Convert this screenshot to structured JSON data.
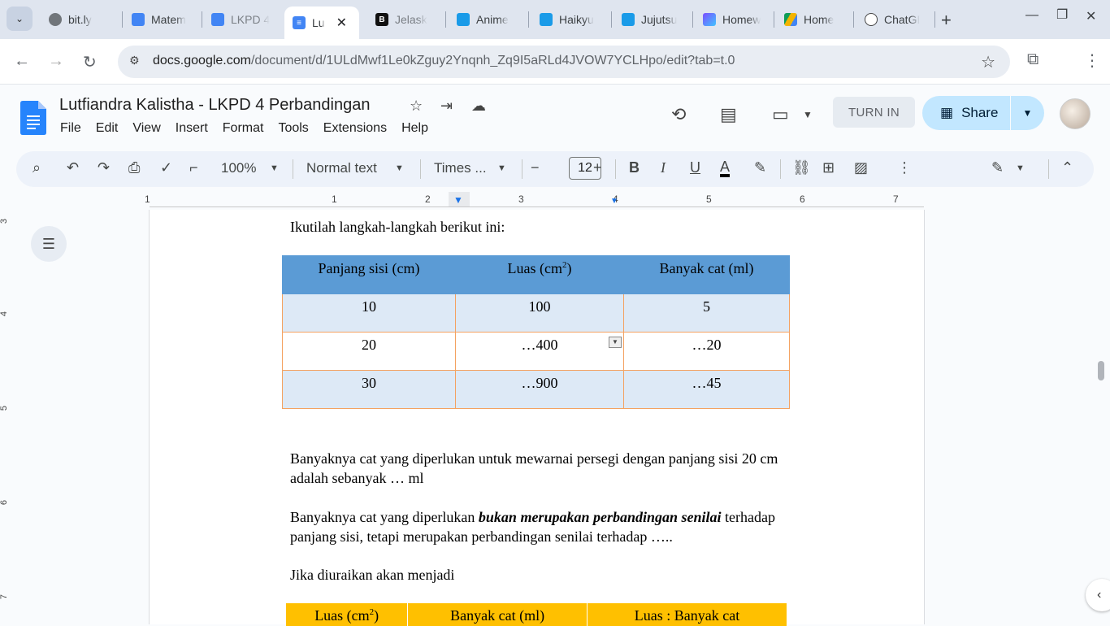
{
  "browser": {
    "tabs": [
      {
        "label": "bit.ly",
        "icon": "globe-icon"
      },
      {
        "label": "Matem",
        "icon": "classroom-icon"
      },
      {
        "label": "LKPD 4",
        "icon": "classroom-icon"
      },
      {
        "label": "Lu",
        "icon": "docs-icon",
        "active": true
      },
      {
        "label": "Jelask",
        "icon": "brainly-icon"
      },
      {
        "label": "Anime",
        "icon": "robot-icon"
      },
      {
        "label": "Haikyu",
        "icon": "robot-icon"
      },
      {
        "label": "Jujutsu",
        "icon": "robot-icon"
      },
      {
        "label": "Homew",
        "icon": "hexagon-icon"
      },
      {
        "label": "Home",
        "icon": "drive-icon"
      },
      {
        "label": "ChatGI",
        "icon": "openai-icon"
      }
    ],
    "url_domain": "docs.google.com",
    "url_path": "/document/d/1ULdMwf1Le0kZguy2Ynqnh_Zq9I5aRLd4JVOW7YCLHpo/edit?tab=t.0"
  },
  "docs": {
    "title": "Lutfiandra Kalistha - LKPD 4 Perbandingan",
    "menu": [
      "File",
      "Edit",
      "View",
      "Insert",
      "Format",
      "Tools",
      "Extensions",
      "Help"
    ],
    "turn_in": "TURN IN",
    "share": "Share"
  },
  "toolbar": {
    "zoom": "100%",
    "style": "Normal text",
    "font": "Times ...",
    "font_size": "12"
  },
  "ruler": {
    "numbers": [
      "1",
      "1",
      "2",
      "3",
      "4",
      "5",
      "6",
      "7"
    ],
    "vertical_numbers": [
      "3",
      "4",
      "5",
      "6",
      "7"
    ]
  },
  "document": {
    "intro": "Ikutilah langkah-langkah berikut ini:",
    "table1": {
      "headers": [
        "Panjang sisi (cm)",
        "Luas (cm",
        "2",
        ")",
        "Banyak cat (ml)"
      ],
      "rows": [
        [
          "10",
          "100",
          "5"
        ],
        [
          "20",
          "…400",
          "…20"
        ],
        [
          "30",
          "…900",
          "…45"
        ]
      ]
    },
    "para1_line1": "Banyaknya cat yang diperlukan untuk mewarnai persegi dengan panjang sisi 20 cm",
    "para1_line2": "adalah sebanyak …   ml",
    "para2_pre": "Banyaknya cat yang diperlukan ",
    "para2_bold": "bukan merupakan perbandingan senilai",
    "para2_post": " terhadap",
    "para2_line2": "panjang sisi, tetapi merupakan perbandingan senilai terhadap …..",
    "para3": "Jika diuraikan akan menjadi",
    "table2": {
      "h1": "Luas (cm",
      "h1_sup": "2",
      "h1_end": ")",
      "h2": "Banyak cat (ml)",
      "h3": "Luas : Banyak cat"
    }
  }
}
